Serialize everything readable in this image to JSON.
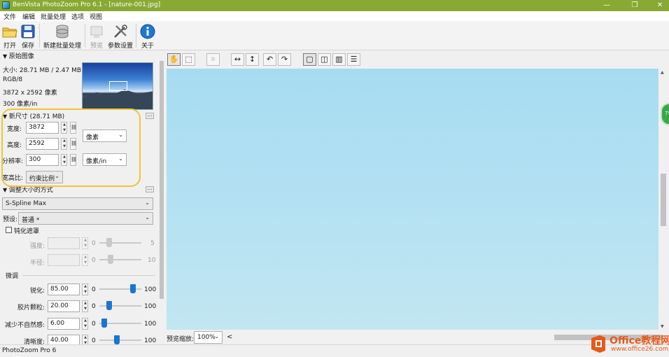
{
  "window": {
    "title": "BenVista PhotoZoom Pro 6.1 - [nature-001.jpg]",
    "minimize": "—",
    "restore": "❐",
    "close": "✕"
  },
  "menu": [
    "文件",
    "编辑",
    "批量处理",
    "选项",
    "视图"
  ],
  "toolbar": {
    "open": "打开",
    "save": "保存",
    "new_batch": "新建批量处理",
    "preview": "预览",
    "settings": "参数设置",
    "about": "关于"
  },
  "original": {
    "header": "原始图像",
    "size": "大小: 28.71 MB / 2.47 MB",
    "mode": "RGB/8",
    "dimensions": "3872 x 2592 像素",
    "resolution": "300 像素/in"
  },
  "new_size": {
    "header": "新尺寸 (28.71 MB)",
    "more": "...",
    "width_label": "宽度:",
    "width_value": "3872",
    "height_label": "高度:",
    "height_value": "2592",
    "unit": "像素",
    "res_label": "分辨率:",
    "res_value": "300",
    "res_unit": "像素/in",
    "aspect_label": "宽高比:",
    "aspect_value": "约束比例",
    "link_glyph": "⛓"
  },
  "resize_method": {
    "header": "调整大小的方式",
    "more": "...",
    "method": "S-Spline Max",
    "preset_label": "预设:",
    "preset_value": "普通 *",
    "sharpen_mask_label": "钝化遮罩",
    "strength_label": "强度:",
    "strength_min": "0",
    "strength_max": "5",
    "radius_label": "半径:",
    "radius_min": "0",
    "radius_max": "10",
    "finetune_header": "微调",
    "rows": [
      {
        "label": "锐化:",
        "value": "85.00",
        "min": "0",
        "max": "100",
        "level": 0.85
      },
      {
        "label": "胶片颗粒:",
        "value": "20.00",
        "min": "0",
        "max": "100",
        "level": 0.2
      },
      {
        "label": "减少不自然感:",
        "value": "6.00",
        "min": "0",
        "max": "100",
        "level": 0.06
      },
      {
        "label": "清晰度:",
        "value": "40.00",
        "min": "0",
        "max": "100",
        "level": 0.4
      }
    ]
  },
  "view": {
    "zoom_label": "预览缩放:",
    "zoom_value": "100%",
    "scroll_left": "<",
    "scroll_right": ">"
  },
  "status": {
    "text": "PhotoZoom Pro 6"
  },
  "badge": {
    "text": "75"
  },
  "watermark": {
    "line1": "Office教程网",
    "line2": "www.office26.com"
  },
  "colors": {
    "titlebar": "#88aa33",
    "accent": "#1976d2",
    "highlight": "#f1c338",
    "sky": "#a6dcf1"
  }
}
